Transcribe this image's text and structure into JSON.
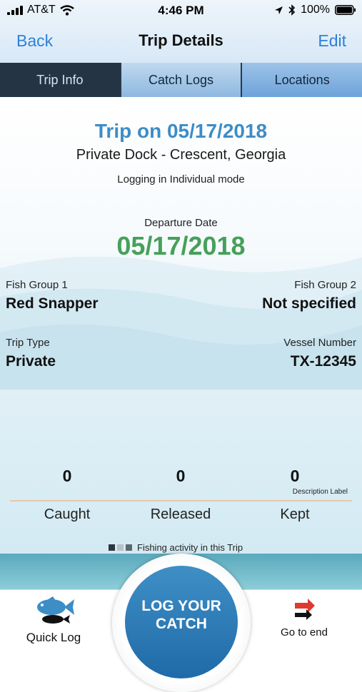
{
  "status_bar": {
    "carrier": "AT&T",
    "time": "4:46 PM",
    "battery": "100%",
    "icons": [
      "signal-icon",
      "wifi-icon",
      "location-icon",
      "bluetooth-icon",
      "battery-icon"
    ]
  },
  "nav": {
    "back_label": "Back",
    "title": "Trip Details",
    "edit_label": "Edit"
  },
  "tabs": [
    {
      "label": "Trip Info",
      "active": true
    },
    {
      "label": "Catch Logs",
      "active": false
    },
    {
      "label": "Locations",
      "active": false
    }
  ],
  "trip": {
    "title": "Trip on 05/17/2018",
    "location": "Private Dock -  Crescent, Georgia",
    "mode": "Logging in Individual mode",
    "departure_label": "Departure Date",
    "departure_date": "05/17/2018",
    "fish_group_1_label": "Fish Group 1",
    "fish_group_1_value": "Red Snapper",
    "fish_group_2_label": "Fish Group 2",
    "fish_group_2_value": "Not specified",
    "trip_type_label": "Trip Type",
    "trip_type_value": "Private",
    "vessel_number_label": "Vessel Number",
    "vessel_number_value": "TX-12345"
  },
  "stats": {
    "caught_count": "0",
    "released_count": "0",
    "kept_count": "0",
    "description_label": "Description Label",
    "caught_label": "Caught",
    "released_label": "Released",
    "kept_label": "Kept",
    "legend_text": "Fishing activity in this Trip"
  },
  "bottom": {
    "quick_log_label": "Quick Log",
    "log_button_line1": "LOG YOUR",
    "log_button_line2": "CATCH",
    "go_to_end_label": "Go to end"
  },
  "colors": {
    "accent_blue": "#2f80d8",
    "title_blue": "#3d8dc6",
    "date_green": "#46a05a",
    "tab_active_bg": "#243444",
    "log_button_blue": "#2c7ab8"
  }
}
